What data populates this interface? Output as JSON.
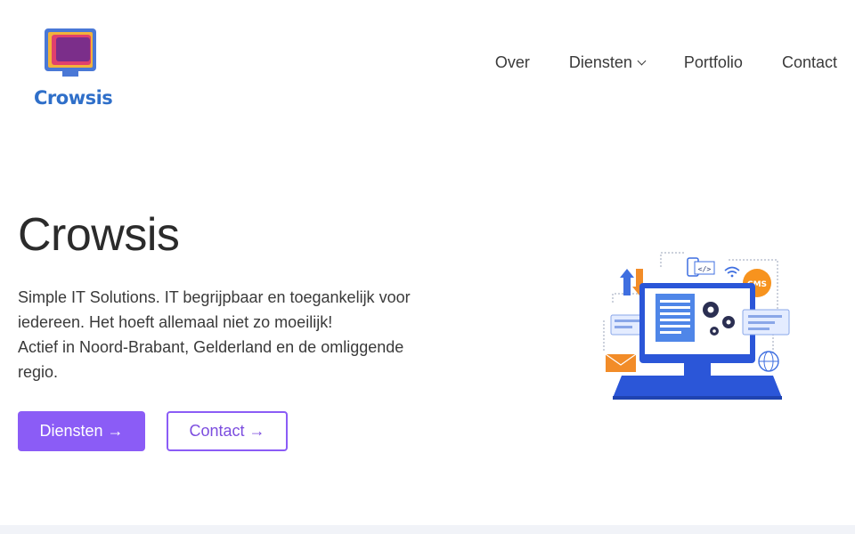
{
  "brand": {
    "name": "Crowsis",
    "colors": {
      "primary": "#8b5cf6",
      "logo_text": "#2f6fc9",
      "illustration_blue": "#2b56d8"
    }
  },
  "nav": {
    "items": [
      {
        "label": "Over"
      },
      {
        "label": "Diensten",
        "has_dropdown": true
      },
      {
        "label": "Portfolio"
      },
      {
        "label": "Contact"
      }
    ]
  },
  "hero": {
    "title": "Crowsis",
    "lines": [
      "Simple IT Solutions. IT begrijpbaar en toegankelijk voor iedereen. Het hoeft allemaal niet zo moeilijk!",
      "Actief in Noord-Brabant, Gelderland en de omliggende regio."
    ],
    "primary_button": "Diensten →",
    "secondary_button": "Contact →"
  },
  "illustration": {
    "icon": "computer-illustration",
    "badge": "CMS",
    "code_tag": "</>"
  }
}
